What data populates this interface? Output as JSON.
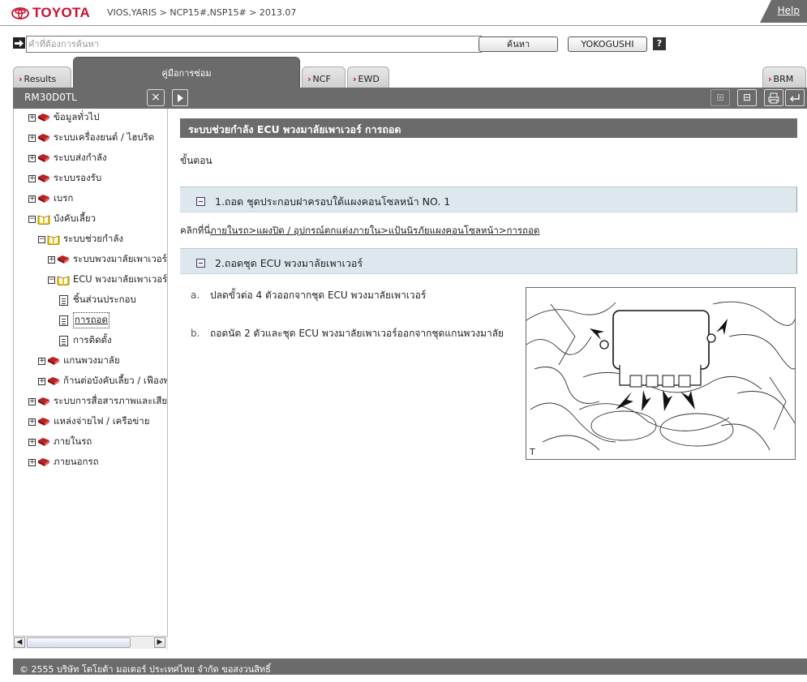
{
  "header": {
    "brand": "TOYOTA",
    "breadcrumb": "VIOS,YARIS > NCP15#,NSP15# > 2013.07",
    "help_label": "Help"
  },
  "search": {
    "placeholder": "คำที่ต้องการค้นหา",
    "search_button": "ค้นหา",
    "yokogushi_button": "YOKOGUSHI",
    "help_button": "?"
  },
  "tabs": [
    {
      "label": "Results",
      "active": false
    },
    {
      "label": "คู่มือการซ่อม",
      "active": true
    },
    {
      "label": "NCF",
      "active": false
    },
    {
      "label": "EWD",
      "active": false
    },
    {
      "label": "BRM",
      "active": false
    }
  ],
  "toolbar": {
    "doc_id": "RM30D0TL",
    "close_icon": "close-icon",
    "expand_icon": "play-icon",
    "right_icons": [
      "expand-all-icon",
      "collapse-all-icon",
      "print-icon",
      "back-icon"
    ]
  },
  "tree": [
    {
      "label": "ข้อมูลทั่วไป",
      "toggle": "+",
      "icon": "book-red",
      "level": 0
    },
    {
      "label": "ระบบเครื่องยนต์ / ไฮบริด",
      "toggle": "+",
      "icon": "book-red",
      "level": 0
    },
    {
      "label": "ระบบส่งกำลัง",
      "toggle": "+",
      "icon": "book-red",
      "level": 0
    },
    {
      "label": "ระบบรองรับ",
      "toggle": "+",
      "icon": "book-red",
      "level": 0
    },
    {
      "label": "เบรก",
      "toggle": "+",
      "icon": "book-red",
      "level": 0
    },
    {
      "label": "บังคับเลี้ยว",
      "toggle": "−",
      "icon": "book-open",
      "level": 0
    },
    {
      "label": "ระบบช่วยกำลัง",
      "toggle": "−",
      "icon": "book-open",
      "level": 1
    },
    {
      "label": "ระบบพวงมาลัยเพาเวอร์",
      "toggle": "+",
      "icon": "book-red",
      "level": 2
    },
    {
      "label": "ECU พวงมาลัยเพาเวอร์",
      "toggle": "−",
      "icon": "book-open",
      "level": 2
    },
    {
      "label": "ชิ้นส่วนประกอบ",
      "toggle": "",
      "icon": "doc",
      "level": 3
    },
    {
      "label": "การถอด",
      "toggle": "",
      "icon": "doc",
      "level": 3,
      "selected": true
    },
    {
      "label": "การติดตั้ง",
      "toggle": "",
      "icon": "doc",
      "level": 3
    },
    {
      "label": "แกนพวงมาลัย",
      "toggle": "+",
      "icon": "book-red",
      "level": 1
    },
    {
      "label": "ก้านต่อบังคับเลี้ยว / เฟืองพ",
      "toggle": "+",
      "icon": "book-red",
      "level": 1
    },
    {
      "label": "ระบบการสื่อสารภาพและเสียง",
      "toggle": "+",
      "icon": "book-red",
      "level": 0
    },
    {
      "label": "แหล่งจ่ายไฟ / เครือข่าย",
      "toggle": "+",
      "icon": "book-red",
      "level": 0
    },
    {
      "label": "ภายในรถ",
      "toggle": "+",
      "icon": "book-red",
      "level": 0
    },
    {
      "label": "ภายนอกรถ",
      "toggle": "+",
      "icon": "book-red",
      "level": 0
    }
  ],
  "content": {
    "title": "ระบบช่วยกำลัง  ECU พวงมาลัยเพาเวอร์  การถอด",
    "steps_label": "ขั้นตอน",
    "step1": "1.ถอด ชุดประกอบฝาครอบใต้แผงคอนโซลหน้า NO. 1",
    "click_prefix": "คลิกที่นี่",
    "click_link": "ภายในรถ>แผงปิด / อุปกรณ์ตกแต่งภายใน>แป้นนิรภัยแผงคอนโซลหน้า>การถอด",
    "step2": "2.ถอดชุด ECU พวงมาลัยเพาเวอร์",
    "sub_a_letter": "a.",
    "sub_a": "ปลดขั้วต่อ 4 ตัวออกจากชุด ECU พวงมาลัยเพาเวอร์",
    "sub_b_letter": "b.",
    "sub_b": "ถอดนัต 2 ตัวและชุด ECU พวงมาลัยเพาเวอร์ออกจากชุดแกนพวงมาลัย",
    "figure_label": "T"
  },
  "footer": {
    "copyright": "© 2555 บริษัท โตโยต้า มอเตอร์ ประเทศไทย จำกัด ขอสงวนสิทธิ์"
  },
  "colors": {
    "brand_red": "#c8102e",
    "bar_gray": "#6b6b6b",
    "step_bg": "#dde8ee"
  }
}
